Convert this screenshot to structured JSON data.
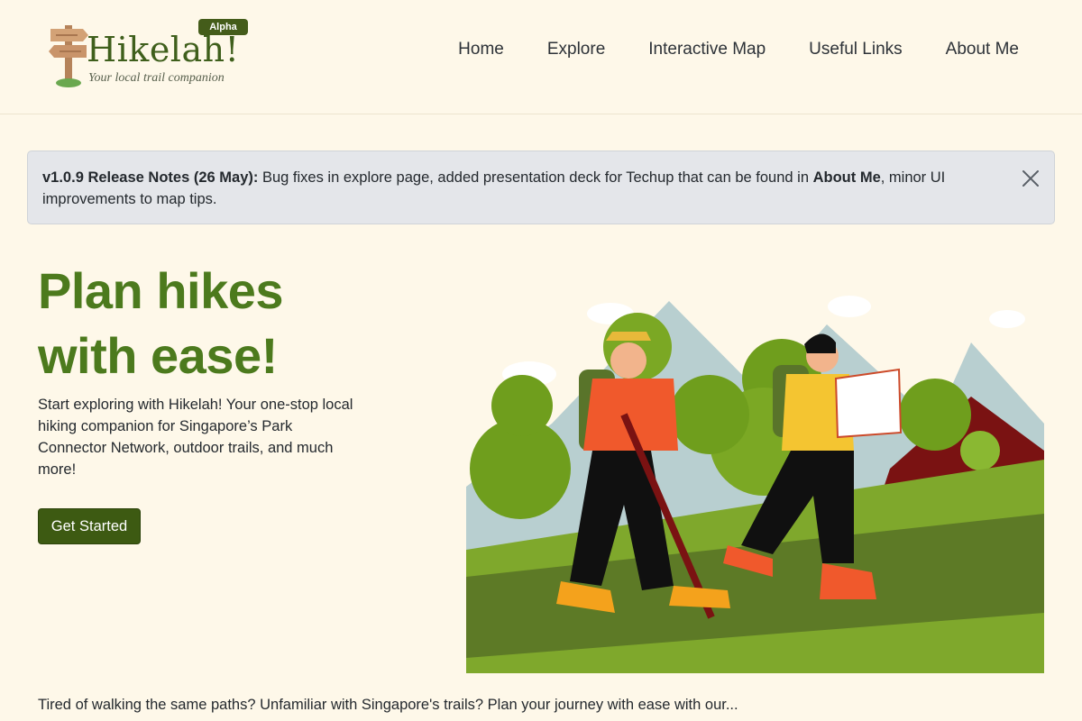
{
  "brand": {
    "name": "Hikelah!",
    "tagline": "Your local trail companion",
    "badge": "Alpha"
  },
  "nav": [
    {
      "label": "Home"
    },
    {
      "label": "Explore"
    },
    {
      "label": "Interactive Map"
    },
    {
      "label": "Useful Links"
    },
    {
      "label": "About Me"
    }
  ],
  "release_note": {
    "title": "v1.0.9 Release Notes (26 May):",
    "body_1": " Bug fixes in explore page, added presentation deck for Techup that can be found in ",
    "emphasis": "About Me",
    "body_2": ", minor UI improvements to map tips.",
    "close_icon": "close-icon"
  },
  "hero": {
    "title_line_1": "Plan hikes",
    "title_line_2": "with ease!",
    "description": "Start exploring with Hikelah! Your one-stop local hiking companion for Singapore’s Park Connector Network, outdoor trails, and much more!",
    "cta_label": "Get Started",
    "illustration": "hikers-illustration"
  },
  "intro": "Tired of walking the same paths? Unfamiliar with Singapore's trails? Plan your journey with ease with our...",
  "colors": {
    "background": "#fef8e9",
    "brand_green": "#3d5a12",
    "title_green": "#4c7a1d",
    "alert_bg": "#e4e6ea"
  }
}
